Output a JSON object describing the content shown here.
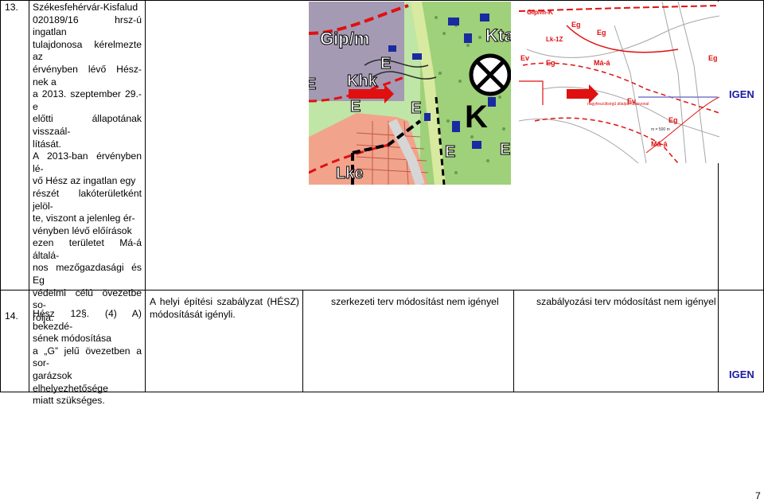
{
  "rows": [
    {
      "num": "13.",
      "desc_lines": [
        "Székesfehérvár-Kisfalud",
        "020189/16 hrsz-ú ingatlan",
        "tulajdonosa kérelmezte az",
        "érvényben lévő Hész-nek a",
        "a 2013. szeptember 29.-e",
        "előtti állapotának visszaál-",
        "lítását.",
        "A 2013-ban érvényben lé-",
        "vő Hész az ingatlan egy",
        "részét lakóterületként jelöl-",
        "te, viszont a jelenleg ér-",
        "vényben lévő előírások",
        "ezen területet Má-á általá-",
        "nos mezőgazdasági és Eg",
        "védelmi célú övezetbe so-",
        "rolja."
      ],
      "answer": "IGEN",
      "map_left_labels": {
        "gip": "Gip/m",
        "kta": "Kta",
        "khk": "Khk",
        "lke": "Lke",
        "e": "E",
        "k": "K"
      },
      "map_right_labels": {
        "gipk": "Gip/m-K",
        "eg1": "Eg",
        "lkf": "Lk-1Z",
        "eg2": "Eg",
        "ev1": "Ev",
        "eg3": "Eg",
        "maa1": "Má-á",
        "eg4": "Eg",
        "nagy": "nagyfeszültségű átlalpárhatárvonal",
        "ev2": "Ev",
        "eg5": "Eg",
        "ma": "m = 500 m",
        "maa2": "Má-á"
      }
    },
    {
      "num": "14.",
      "desc_lines": [
        "Hész 12§. (4) A) bekezdé-",
        "sének módosítása",
        "a „G” jelű övezetben a sor-",
        "garázsok elhelyezhetősége",
        "miatt szükséges."
      ],
      "hesz": "A helyi építési szabályzat (HÉSZ) módosítását igényli.",
      "szerk": "szerkezeti terv módosítást nem igényel",
      "szab": "szabályozási terv módosítást nem igényel",
      "answer": "IGEN"
    }
  ],
  "page_number": "7",
  "colors": {
    "answer": "#1a1aa6",
    "arrow_red": "#e01010",
    "zone_purple": "#a59ab3",
    "zone_green": "#9fd07a",
    "zone_salmon": "#f2a38c"
  }
}
